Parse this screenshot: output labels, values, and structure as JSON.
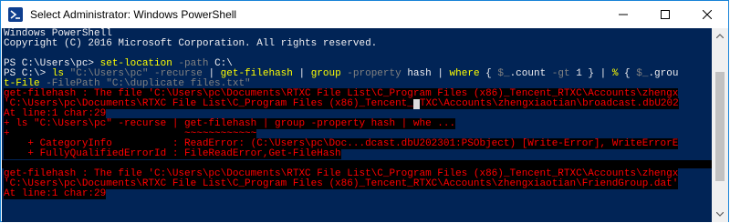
{
  "window": {
    "title": "Select Administrator: Windows PowerShell",
    "controls": {
      "minimize": "minimize-icon",
      "maximize": "maximize-icon",
      "close": "close-icon"
    }
  },
  "console": {
    "lines": [
      {
        "segments": [
          {
            "text": "Windows PowerShell",
            "style": "w"
          }
        ]
      },
      {
        "segments": [
          {
            "text": "Copyright (C) 2016 Microsoft Corporation. All rights reserved.",
            "style": "w"
          }
        ]
      },
      {
        "segments": [
          {
            "text": "",
            "style": "w"
          }
        ]
      },
      {
        "segments": [
          {
            "text": "PS C:\\Users\\pc> ",
            "style": "w"
          },
          {
            "text": "set-location",
            "style": "y"
          },
          {
            "text": " -path ",
            "style": "g"
          },
          {
            "text": "C:\\",
            "style": "w"
          }
        ]
      },
      {
        "segments": [
          {
            "text": "PS C:\\> ",
            "style": "w"
          },
          {
            "text": "ls",
            "style": "y"
          },
          {
            "text": " \"C:\\Users\\pc\" -recurse ",
            "style": "g"
          },
          {
            "text": "| ",
            "style": "w"
          },
          {
            "text": "get-filehash",
            "style": "y"
          },
          {
            "text": " | ",
            "style": "w"
          },
          {
            "text": "group",
            "style": "y"
          },
          {
            "text": " -property ",
            "style": "g"
          },
          {
            "text": "hash | ",
            "style": "w"
          },
          {
            "text": "where",
            "style": "y"
          },
          {
            "text": " { ",
            "style": "w"
          },
          {
            "text": "$_",
            "style": "g"
          },
          {
            "text": ".count ",
            "style": "w"
          },
          {
            "text": "-gt",
            "style": "g"
          },
          {
            "text": " 1 } | ",
            "style": "w"
          },
          {
            "text": "%",
            "style": "y"
          },
          {
            "text": " { ",
            "style": "w"
          },
          {
            "text": "$_",
            "style": "g"
          },
          {
            "text": ".grou",
            "style": "w"
          }
        ]
      },
      {
        "segments": [
          {
            "text": "t-File",
            "style": "y"
          },
          {
            "text": " -FilePath \"C:\\duplicate files.txt\"",
            "style": "g"
          }
        ]
      },
      {
        "segments": [
          {
            "text": "get-filehash : The file 'C:\\Users\\pc\\Documents\\RTXC File List\\C_Program Files (x86)_Tencent_RTXC\\Accounts\\zhengx",
            "style": "err"
          }
        ]
      },
      {
        "segments": [
          {
            "text": "'C:\\Users\\pc\\Documents\\RTXC File List\\C_Program Files (x86)_Tencent_",
            "style": "err"
          },
          {
            "text": "CURSOR",
            "style": "cursor"
          },
          {
            "text": "TXC\\Accounts\\zhengxiaotian\\broadcast.dbU202",
            "style": "err"
          }
        ]
      },
      {
        "segments": [
          {
            "text": "At line:1 char:29",
            "style": "err"
          }
        ]
      },
      {
        "segments": [
          {
            "text": "+ ls \"C:\\Users\\pc\" -recurse | get-filehash | group -property hash | whe ...",
            "style": "err"
          }
        ]
      },
      {
        "segments": [
          {
            "text": "+                             ~~~~~~~~~~~~",
            "style": "err"
          }
        ]
      },
      {
        "segments": [
          {
            "text": "    + CategoryInfo          : ReadError: (C:\\Users\\pc\\Doc...dcast.dbU202301:PSObject) [Write-Error], WriteErrorE",
            "style": "err"
          }
        ]
      },
      {
        "segments": [
          {
            "text": "    + FullyQualifiedErrorId : FileReadError,Get-FileHash",
            "style": "err"
          }
        ]
      },
      {
        "segments": [
          {
            "text": "",
            "style": "blank"
          }
        ]
      },
      {
        "segments": [
          {
            "text": "get-filehash : The file 'C:\\Users\\pc\\Documents\\RTXC File List\\C_Program Files (x86)_Tencent_RTXC\\Accounts\\zhengx",
            "style": "err"
          }
        ]
      },
      {
        "segments": [
          {
            "text": "'C:\\Users\\pc\\Documents\\RTXC File List\\C_Program Files (x86)_Tencent_RTXC\\Accounts\\zhengxiaotian\\FriendGroup.dat'",
            "style": "err"
          }
        ]
      },
      {
        "segments": [
          {
            "text": "At line:1 char:29",
            "style": "err"
          }
        ]
      }
    ]
  },
  "colors": {
    "console_bg": "#012456",
    "error_fg": "#ff0000",
    "error_bg": "#000000",
    "title_border": "#1883d7"
  }
}
